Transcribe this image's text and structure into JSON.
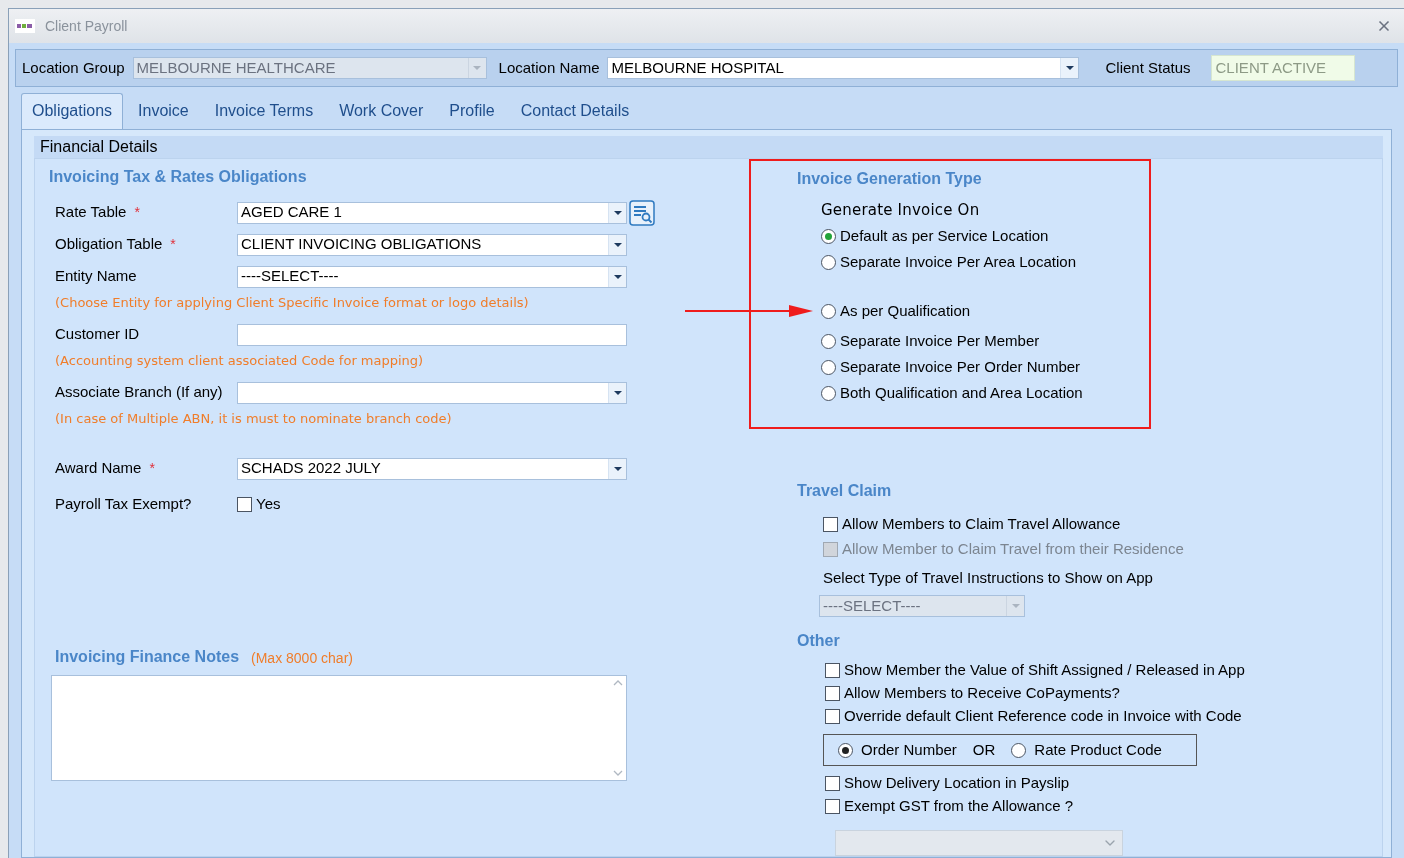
{
  "window": {
    "title": "Client Payroll"
  },
  "header": {
    "location_group": {
      "label": "Location Group",
      "value": "MELBOURNE HEALTHCARE",
      "disabled": true
    },
    "location_name": {
      "label": "Location Name",
      "value": "MELBOURNE HOSPITAL",
      "disabled": false
    },
    "client_status": {
      "label": "Client Status",
      "value": "CLIENT ACTIVE"
    }
  },
  "tabs": [
    {
      "label": "Obligations",
      "selected": true
    },
    {
      "label": "Invoice",
      "selected": false
    },
    {
      "label": "Invoice Terms",
      "selected": false
    },
    {
      "label": "Work Cover",
      "selected": false
    },
    {
      "label": "Profile",
      "selected": false
    },
    {
      "label": "Contact Details",
      "selected": false
    }
  ],
  "section_title": "Financial Details",
  "obligations": {
    "title": "Invoicing Tax & Rates Obligations",
    "rows": [
      {
        "kind": "select",
        "label": "Rate Table",
        "mark": "*",
        "value": "AGED CARE 1",
        "lookup": true
      },
      {
        "kind": "select",
        "label": "Obligation Table",
        "mark": "*",
        "value": "CLIENT INVOICING OBLIGATIONS",
        "lookup": false
      },
      {
        "kind": "select",
        "label": "Entity Name",
        "value": "----SELECT----",
        "lookup": false
      },
      {
        "kind": "hint",
        "text": "(Choose Entity for applying Client Specific Invoice format or logo details)"
      },
      {
        "kind": "input",
        "label": "Customer ID"
      },
      {
        "kind": "hint",
        "text": "(Accounting system client associated Code for mapping)"
      },
      {
        "kind": "select",
        "label": "Associate Branch (If any)",
        "lookup": false
      },
      {
        "kind": "hint",
        "text": "(In case of Multiple ABN, it is must to nominate branch code)"
      },
      {
        "kind": "select",
        "label": "Award Name",
        "mark": "*",
        "value": "SCHADS 2022 JULY",
        "lookup": false
      },
      {
        "kind": "checkbox",
        "label": "Payroll Tax Exempt?",
        "option": "Yes",
        "checked": false
      }
    ]
  },
  "notes": {
    "title": "Invoicing Finance Notes",
    "hint": "(Max 8000 char)"
  },
  "invoice_generation": {
    "title": "Invoice Generation Type",
    "subtitle": "Generate Invoice On",
    "option_groups": [
      [
        {
          "label": "Default as per Service Location",
          "selected": true
        },
        {
          "label": "Separate Invoice Per Area Location",
          "selected": false
        }
      ],
      [
        {
          "label": "As per Qualification",
          "selected": false
        },
        {
          "label": "Separate Invoice Per Member",
          "selected": false
        },
        {
          "label": "Separate Invoice Per Order Number",
          "selected": false
        },
        {
          "label": "Both Qualification and Area Location",
          "selected": false
        }
      ]
    ]
  },
  "travel_claim": {
    "title": "Travel Claim",
    "options": [
      {
        "label": "Allow Members to Claim Travel Allowance",
        "checked": false,
        "disabled": false
      },
      {
        "label": "Allow Member to Claim Travel from their Residence",
        "checked": false,
        "disabled": true
      }
    ],
    "instruction": "Select Type of Travel Instructions to Show on App",
    "select": {
      "value": "----SELECT----",
      "disabled": true
    }
  },
  "other": {
    "title": "Other",
    "items": [
      {
        "kind": "checkbox",
        "label": "Show Member the Value of Shift Assigned / Released in App",
        "checked": false
      },
      {
        "kind": "checkbox",
        "label": "Allow Members to Receive CoPayments?",
        "checked": false
      },
      {
        "kind": "checkbox",
        "label": "Override default Client Reference code in Invoice with Code",
        "checked": false
      },
      {
        "kind": "radio_group",
        "separator": "OR",
        "options": [
          {
            "label": "Order Number",
            "selected": true
          },
          {
            "label": "Rate Product Code",
            "selected": false
          }
        ]
      },
      {
        "kind": "checkbox",
        "label": "Show Delivery Location in Payslip",
        "checked": false
      },
      {
        "kind": "checkbox",
        "label": "Exempt GST from the Allowance ?",
        "checked": false
      },
      {
        "kind": "select",
        "disabled": true
      }
    ]
  }
}
